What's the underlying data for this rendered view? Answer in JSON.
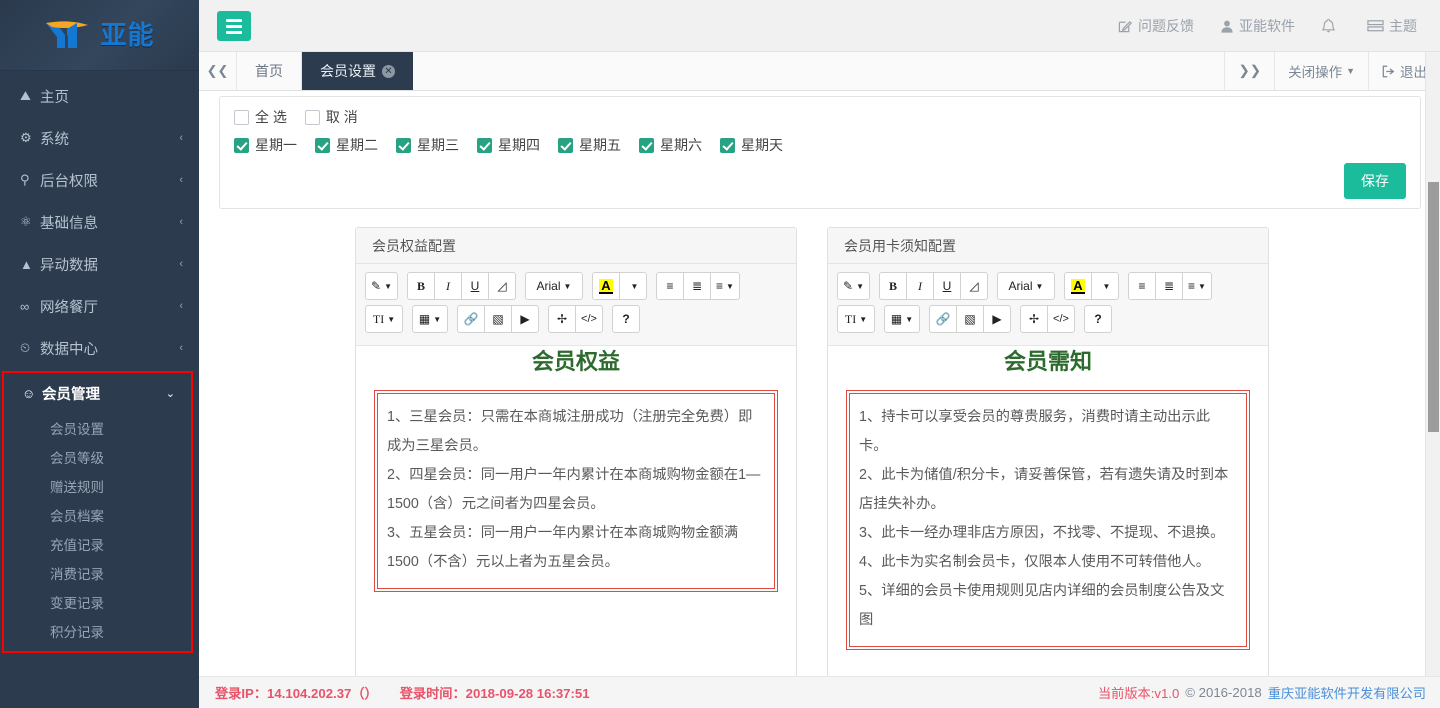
{
  "sidebar": {
    "logo": {
      "text": "亚能",
      "mark": "YN",
      "mark_color": "#1477d1",
      "accent_color": "#f5a623"
    },
    "items": [
      {
        "label": "主页",
        "icon": "home-icon",
        "caret": ""
      },
      {
        "label": "系统",
        "icon": "gear-icon",
        "caret": "‹"
      },
      {
        "label": "后台权限",
        "icon": "key-icon",
        "caret": "‹"
      },
      {
        "label": "基础信息",
        "icon": "cogs-icon",
        "caret": "‹"
      },
      {
        "label": "异动数据",
        "icon": "warning-icon",
        "caret": "‹"
      },
      {
        "label": "网络餐厅",
        "icon": "link-icon",
        "caret": "‹"
      },
      {
        "label": "数据中心",
        "icon": "chart-icon",
        "caret": "‹"
      }
    ],
    "member_group": {
      "label": "会员管理",
      "icon": "users-icon",
      "caret": "⌄",
      "highlight_color": "#ff0000",
      "sub_items": [
        {
          "label": "会员设置"
        },
        {
          "label": "会员等级"
        },
        {
          "label": "赠送规则"
        },
        {
          "label": "会员档案"
        },
        {
          "label": "充值记录"
        },
        {
          "label": "消费记录"
        },
        {
          "label": "变更记录"
        },
        {
          "label": "积分记录"
        }
      ]
    }
  },
  "topbar": {
    "toggle_icon": "hamburger-icon",
    "toggle_color": "#1abc9c",
    "links": [
      {
        "label": "问题反馈",
        "icon": "edit-square-icon"
      },
      {
        "label": "亚能软件",
        "icon": "user-icon"
      },
      {
        "label": "",
        "icon": "bell-icon"
      },
      {
        "label": "主题",
        "icon": "theme-icon"
      }
    ]
  },
  "tabbar": {
    "prev_icon": "double-chevron-left-icon",
    "next_icon": "double-chevron-right-icon",
    "tabs": [
      {
        "label": "首页",
        "active": false,
        "closable": false
      },
      {
        "label": "会员设置",
        "active": true,
        "closable": true,
        "close_icon": "close-circle-icon"
      }
    ],
    "right_items": [
      {
        "label": "关闭操作",
        "icon": "chevron-down-icon"
      },
      {
        "label": "退出",
        "icon": "logout-icon"
      }
    ]
  },
  "weekday_panel": {
    "select_all": {
      "label": "全  选",
      "checked": false
    },
    "cancel_all": {
      "label": "取  消",
      "checked": false
    },
    "days": [
      {
        "label": "星期一",
        "checked": true
      },
      {
        "label": "星期二",
        "checked": true
      },
      {
        "label": "星期三",
        "checked": true
      },
      {
        "label": "星期四",
        "checked": true
      },
      {
        "label": "星期五",
        "checked": true
      },
      {
        "label": "星期六",
        "checked": true
      },
      {
        "label": "星期天",
        "checked": true
      }
    ],
    "save_label": "保存",
    "save_color": "#1abc9c"
  },
  "editor_toolbar": {
    "row1": [
      {
        "name": "style-picker",
        "glyph": "✎",
        "caret": true
      },
      {
        "name": "bold",
        "glyph": "B"
      },
      {
        "name": "italic",
        "glyph": "I"
      },
      {
        "name": "underline",
        "glyph": "U"
      },
      {
        "name": "eraser",
        "glyph": "◣"
      },
      {
        "name": "font-family",
        "glyph": "Arial",
        "caret": true
      },
      {
        "name": "text-color",
        "glyph": "A",
        "caret": false,
        "highlight": "#ffff00"
      },
      {
        "name": "text-color-more",
        "glyph": "",
        "caret": true
      },
      {
        "name": "unordered-list",
        "glyph": "☰"
      },
      {
        "name": "ordered-list",
        "glyph": "☷"
      },
      {
        "name": "align",
        "glyph": "≡",
        "caret": true
      }
    ],
    "row2": [
      {
        "name": "text-size",
        "glyph": "TI",
        "caret": true
      },
      {
        "name": "table",
        "glyph": "▦",
        "caret": true
      },
      {
        "name": "link",
        "glyph": "🔗"
      },
      {
        "name": "image",
        "glyph": "🖼"
      },
      {
        "name": "video",
        "glyph": "▶"
      },
      {
        "name": "fullscreen",
        "glyph": "⤢"
      },
      {
        "name": "source-code",
        "glyph": "</>"
      },
      {
        "name": "help",
        "glyph": "?"
      }
    ]
  },
  "cards": [
    {
      "title": "会员权益配置",
      "doc_title": "会员权益",
      "doc_title_color": "#2d6a2d",
      "frame_color": "#e04a3f",
      "paragraphs": [
        "1、三星会员：只需在本商城注册成功（注册完全免费）即成为三星会员。",
        "2、四星会员：同一用户一年内累计在本商城购物金额在1—1500（含）元之间者为四星会员。",
        "3、五星会员：同一用户一年内累计在本商城购物金额满1500（不含）元以上者为五星会员。"
      ]
    },
    {
      "title": "会员用卡须知配置",
      "doc_title": "会员需知",
      "doc_title_color": "#2d6a2d",
      "frame_color": "#e04a3f",
      "paragraphs": [
        "1、持卡可以享受会员的尊贵服务，消费时请主动出示此卡。",
        "2、此卡为储值/积分卡，请妥善保管，若有遗失请及时到本店挂失补办。",
        "3、此卡一经办理非店方原因，不找零、不提现、不退换。",
        "4、此卡为实名制会员卡，仅限本人使用不可转借他人。",
        "5、详细的会员卡使用规则见店内详细的会员制度公告及文图"
      ]
    }
  ],
  "footer": {
    "login_ip": "登录IP：14.104.202.37（）",
    "login_time": "登录时间：2018-09-28 16:37:51",
    "version": "当前版本:v1.0",
    "copyright": "© 2016-2018",
    "company": "重庆亚能软件开发有限公司"
  }
}
